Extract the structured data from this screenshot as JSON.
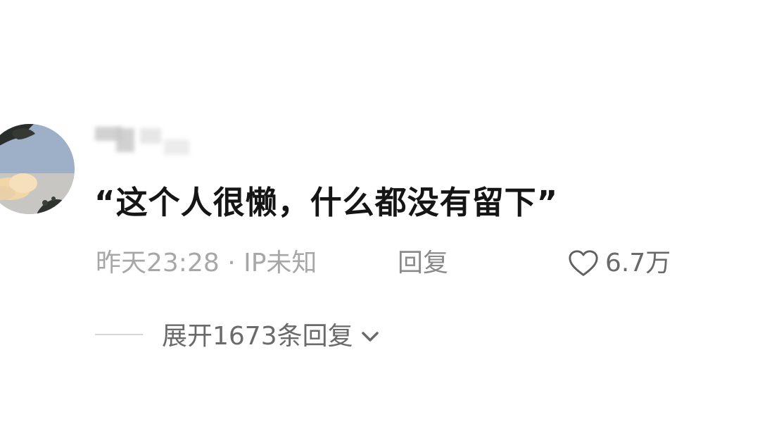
{
  "comment": {
    "text": "“这个人很懒，什么都没有留下”",
    "time_location": "昨天23:28 · IP未知",
    "reply_label": "回复",
    "like_count": "6.7万"
  },
  "expand_replies": {
    "label": "展开1673条回复"
  },
  "icons": {
    "like": "heart-outline-icon",
    "expand": "chevron-down-icon"
  },
  "colors": {
    "text_primary": "#151515",
    "text_secondary": "#a7a7a7",
    "text_tertiary": "#6a6a6a"
  }
}
